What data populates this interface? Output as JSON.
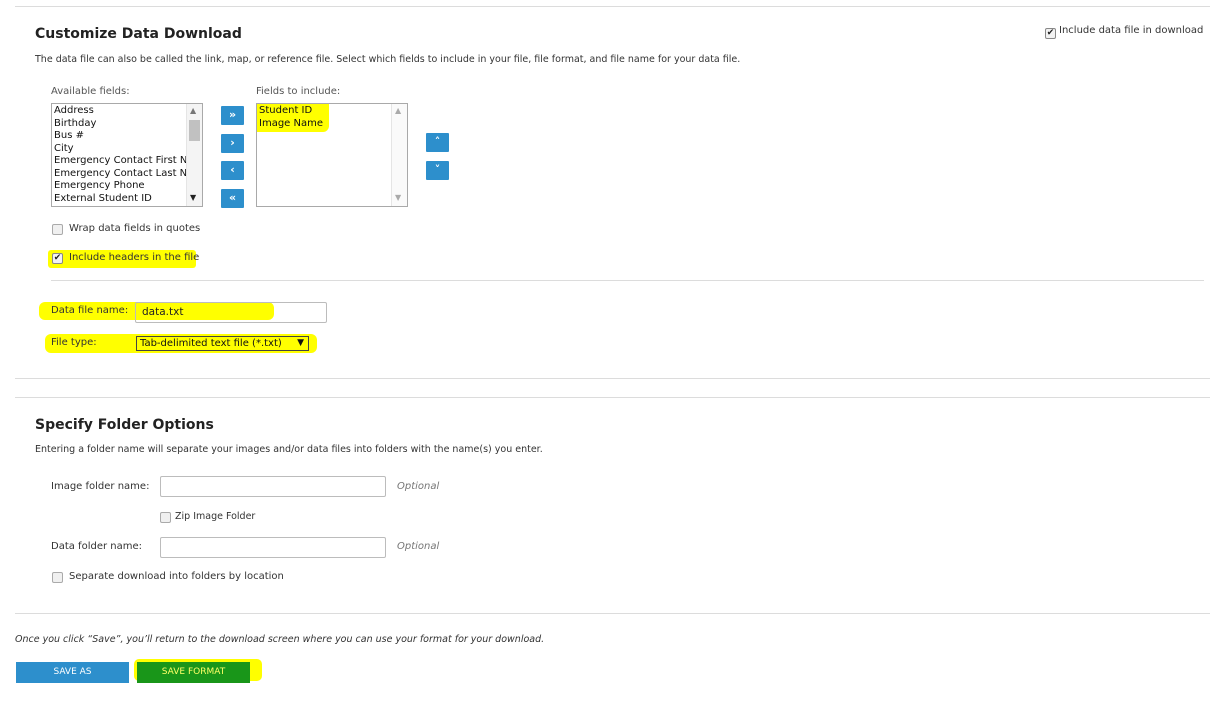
{
  "customize": {
    "title": "Customize Data Download",
    "include_in_download_label": "Include data file in download",
    "include_in_download_checked": true,
    "description": "The data file can also be called the link, map, or reference file. Select which fields to include in your file, file format, and file name for your data file.",
    "available_label": "Available fields:",
    "available_fields": [
      "Address",
      "Birthday",
      "Bus #",
      "City",
      "Emergency Contact First Na",
      "Emergency Contact Last Na",
      "Emergency Phone",
      "External Student ID"
    ],
    "include_label": "Fields to include:",
    "included_fields": [
      "Student ID",
      "Image Name"
    ],
    "move_buttons": {
      "add_all": "»",
      "add": "›",
      "remove": "‹",
      "remove_all": "«"
    },
    "order_buttons": {
      "up": "˄",
      "down": "˅"
    },
    "wrap_quotes_label": "Wrap data fields in quotes",
    "wrap_quotes_checked": false,
    "include_headers_label": "Include headers in the file",
    "include_headers_checked": true,
    "file_name_label": "Data file name:",
    "file_name_value": "data.txt",
    "file_type_label": "File type:",
    "file_type_value": "Tab-delimited text file (*.txt)",
    "select_arrow": "▼"
  },
  "folders": {
    "title": "Specify Folder Options",
    "description": "Entering a folder name will separate your images and/or data files into folders with the name(s) you enter.",
    "image_folder_label": "Image folder name:",
    "image_folder_value": "",
    "optional_label": "Optional",
    "zip_label": "Zip Image Folder",
    "zip_checked": false,
    "data_folder_label": "Data folder name:",
    "data_folder_value": "",
    "separate_label": "Separate download into folders by location",
    "separate_checked": false
  },
  "footer": {
    "note": "Once you click “Save”, you’ll return to the download screen where you can use your format for your download.",
    "save_as_label": "SAVE AS",
    "save_format_label": "SAVE FORMAT"
  },
  "colors": {
    "button_blue": "#2d8fcc",
    "save_format_green": "#199619",
    "highlight": "#ffff00"
  },
  "icons": {
    "checkmark": "check-icon",
    "scroll_up": "scroll-up-icon",
    "scroll_down": "scroll-down-icon"
  }
}
